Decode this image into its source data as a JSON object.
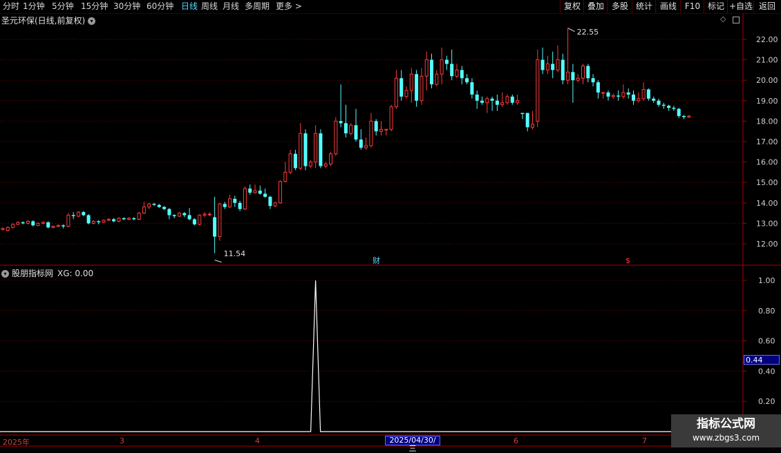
{
  "periods": [
    "分时",
    "1分钟",
    "5分钟",
    "15分钟",
    "30分钟",
    "60分钟",
    "日线",
    "周线",
    "月线",
    "多周期",
    "更多 >"
  ],
  "active_period": "日线",
  "right_buttons": [
    "复权",
    "叠加",
    "多股",
    "统计",
    "画线",
    "F10",
    "标记",
    "+自选",
    "返回"
  ],
  "stock_title": "圣元环保(日线,前复权)",
  "title_icon": "chevron-down-icon",
  "price_axis": [
    "22.00",
    "21.00",
    "20.00",
    "19.00",
    "18.00",
    "17.00",
    "16.00",
    "15.00",
    "14.00",
    "13.00",
    "12.00"
  ],
  "high_label": "22.55",
  "low_label": "11.54",
  "event_markers": [
    "财",
    "$"
  ],
  "indicator_name": "股朋指标网",
  "indicator_value": "XG: 0.00",
  "indicator_axis": [
    "1.00",
    "0.80",
    "0.60",
    "0.40",
    "0.20"
  ],
  "cursor_value": "0.44",
  "date_axis": [
    "2025年",
    "3",
    "4",
    "6",
    "7"
  ],
  "cursor_date": "2025/04/30/三",
  "watermark": {
    "title": "指标公式网",
    "url": "www.zbgs3.com"
  },
  "colors": {
    "up": "#ff3c3c",
    "down": "#54ffff",
    "grid": "#8b0000",
    "active": "#5ad7ff",
    "cursor_bg": "#000080"
  },
  "chart_data": {
    "type": "candlestick",
    "ylim": [
      11.3,
      22.7
    ],
    "candles": [
      [
        12.7,
        12.75,
        12.65,
        12.8
      ],
      [
        12.65,
        12.8,
        12.6,
        12.85
      ],
      [
        12.8,
        12.95,
        12.75,
        13.0
      ],
      [
        12.95,
        13.05,
        12.9,
        13.1
      ],
      [
        13.05,
        13.0,
        12.95,
        13.1
      ],
      [
        13.0,
        13.1,
        12.95,
        13.15
      ],
      [
        13.1,
        12.9,
        12.85,
        13.15
      ],
      [
        12.9,
        13.0,
        12.85,
        13.05
      ],
      [
        13.0,
        13.05,
        12.95,
        13.1
      ],
      [
        13.05,
        12.8,
        12.75,
        13.1
      ],
      [
        12.8,
        12.85,
        12.75,
        12.9
      ],
      [
        12.85,
        12.9,
        12.8,
        12.95
      ],
      [
        12.9,
        12.85,
        12.75,
        12.95
      ],
      [
        12.85,
        13.4,
        12.8,
        13.5
      ],
      [
        13.4,
        13.35,
        13.2,
        13.55
      ],
      [
        13.35,
        13.55,
        13.3,
        13.6
      ],
      [
        13.55,
        13.4,
        13.35,
        13.6
      ],
      [
        13.4,
        13.0,
        12.95,
        13.45
      ],
      [
        13.0,
        13.1,
        12.95,
        13.15
      ],
      [
        13.1,
        13.05,
        12.95,
        13.15
      ],
      [
        13.05,
        13.15,
        13.0,
        13.2
      ],
      [
        13.15,
        13.2,
        13.1,
        13.25
      ],
      [
        13.2,
        13.1,
        13.05,
        13.25
      ],
      [
        13.1,
        13.25,
        13.05,
        13.3
      ],
      [
        13.25,
        13.2,
        13.15,
        13.3
      ],
      [
        13.2,
        13.25,
        13.15,
        13.3
      ],
      [
        13.25,
        13.2,
        13.15,
        13.3
      ],
      [
        13.2,
        13.5,
        13.15,
        13.55
      ],
      [
        13.5,
        13.8,
        13.45,
        14.05
      ],
      [
        13.8,
        13.95,
        13.7,
        14.0
      ],
      [
        13.95,
        13.9,
        13.85,
        14.0
      ],
      [
        13.9,
        13.8,
        13.75,
        13.95
      ],
      [
        13.8,
        13.7,
        13.65,
        13.85
      ],
      [
        13.7,
        13.4,
        13.2,
        13.75
      ],
      [
        13.4,
        13.35,
        13.25,
        13.45
      ],
      [
        13.35,
        13.5,
        13.3,
        13.55
      ],
      [
        13.5,
        13.4,
        13.3,
        13.55
      ],
      [
        13.4,
        13.2,
        13.15,
        13.75
      ],
      [
        13.2,
        12.95,
        12.9,
        13.25
      ],
      [
        12.95,
        13.4,
        12.9,
        13.45
      ],
      [
        13.4,
        13.45,
        13.3,
        13.55
      ],
      [
        13.45,
        13.45,
        13.35,
        13.55
      ],
      [
        13.3,
        12.35,
        11.54,
        14.3
      ],
      [
        12.35,
        13.95,
        12.15,
        14.0
      ],
      [
        13.95,
        13.8,
        13.7,
        14.05
      ],
      [
        13.8,
        14.2,
        13.75,
        14.4
      ],
      [
        14.2,
        14.0,
        13.8,
        14.35
      ],
      [
        14.0,
        13.7,
        13.6,
        14.1
      ],
      [
        13.7,
        14.7,
        13.65,
        14.8
      ],
      [
        14.7,
        14.5,
        14.4,
        14.9
      ],
      [
        14.5,
        14.6,
        14.45,
        14.9
      ],
      [
        14.6,
        14.45,
        14.4,
        14.85
      ],
      [
        14.45,
        14.3,
        14.25,
        14.7
      ],
      [
        14.3,
        13.85,
        13.7,
        14.35
      ],
      [
        13.85,
        14.0,
        13.8,
        14.05
      ],
      [
        14.0,
        15.05,
        13.95,
        15.1
      ],
      [
        15.05,
        15.5,
        15.0,
        16.0
      ],
      [
        15.5,
        16.4,
        15.4,
        16.6
      ],
      [
        16.4,
        15.7,
        15.6,
        16.6
      ],
      [
        15.7,
        17.4,
        15.6,
        17.9
      ],
      [
        17.4,
        15.8,
        15.6,
        17.6
      ],
      [
        15.8,
        16.0,
        15.7,
        16.1
      ],
      [
        16.0,
        17.4,
        15.7,
        17.8
      ],
      [
        17.4,
        15.8,
        15.7,
        17.6
      ],
      [
        15.8,
        15.9,
        15.7,
        16.0
      ],
      [
        15.9,
        16.4,
        15.8,
        16.5
      ],
      [
        16.4,
        18.0,
        16.3,
        18.2
      ],
      [
        18.0,
        17.9,
        17.7,
        19.8
      ],
      [
        17.9,
        17.4,
        17.2,
        18.8
      ],
      [
        17.4,
        17.8,
        17.3,
        17.9
      ],
      [
        17.8,
        17.1,
        17.0,
        18.6
      ],
      [
        17.1,
        16.7,
        16.6,
        17.6
      ],
      [
        16.7,
        16.8,
        16.6,
        17.2
      ],
      [
        16.8,
        18.0,
        16.7,
        18.4
      ],
      [
        18.0,
        17.5,
        17.3,
        18.1
      ],
      [
        17.5,
        17.6,
        17.3,
        18.0
      ],
      [
        17.6,
        17.6,
        17.3,
        17.6
      ],
      [
        17.6,
        18.7,
        17.5,
        18.8
      ],
      [
        18.7,
        20.1,
        18.6,
        20.5
      ],
      [
        20.1,
        19.2,
        19.0,
        20.5
      ],
      [
        19.2,
        19.5,
        19.1,
        19.7
      ],
      [
        19.5,
        20.3,
        18.9,
        20.6
      ],
      [
        20.3,
        19.0,
        18.7,
        20.5
      ],
      [
        19.0,
        20.2,
        18.8,
        20.6
      ],
      [
        20.2,
        21.0,
        19.5,
        21.4
      ],
      [
        21.0,
        19.8,
        19.6,
        21.3
      ],
      [
        19.8,
        20.3,
        19.7,
        20.5
      ],
      [
        20.3,
        21.0,
        19.8,
        21.6
      ],
      [
        21.0,
        20.8,
        20.5,
        21.2
      ],
      [
        20.8,
        20.2,
        20.0,
        21.5
      ],
      [
        20.2,
        20.5,
        20.1,
        20.8
      ],
      [
        20.5,
        20.1,
        19.8,
        20.7
      ],
      [
        20.1,
        19.9,
        19.8,
        20.3
      ],
      [
        19.9,
        19.3,
        19.1,
        20.1
      ],
      [
        19.3,
        19.0,
        18.6,
        19.5
      ],
      [
        19.0,
        18.9,
        18.8,
        19.2
      ],
      [
        18.9,
        19.1,
        18.4,
        19.2
      ],
      [
        19.1,
        19.0,
        18.5,
        19.2
      ],
      [
        19.0,
        18.8,
        18.5,
        19.3
      ],
      [
        18.8,
        18.9,
        18.7,
        19.4
      ],
      [
        18.9,
        19.2,
        18.8,
        19.3
      ],
      [
        19.2,
        18.9,
        18.8,
        19.3
      ],
      [
        18.9,
        19.0,
        18.8,
        19.3
      ],
      [
        18.4,
        18.35,
        18.1,
        18.4
      ],
      [
        18.4,
        17.7,
        17.5,
        18.4
      ],
      [
        17.7,
        17.85,
        17.6,
        18.5
      ],
      [
        18.0,
        21.0,
        17.7,
        21.5
      ],
      [
        21.0,
        20.5,
        20.3,
        21.6
      ],
      [
        20.5,
        20.8,
        20.3,
        21.2
      ],
      [
        20.8,
        20.5,
        20.1,
        21.4
      ],
      [
        20.5,
        21.0,
        20.4,
        21.7
      ],
      [
        21.0,
        20.0,
        19.8,
        21.3
      ],
      [
        20.0,
        20.4,
        19.8,
        22.55
      ],
      [
        20.4,
        20.0,
        18.9,
        20.8
      ],
      [
        20.0,
        20.1,
        19.9,
        20.3
      ],
      [
        20.1,
        20.7,
        19.8,
        20.8
      ],
      [
        20.7,
        20.1,
        19.9,
        20.8
      ],
      [
        20.1,
        19.9,
        19.7,
        20.3
      ],
      [
        19.9,
        19.4,
        19.1,
        20.0
      ],
      [
        19.4,
        19.4,
        19.1,
        19.4
      ],
      [
        19.4,
        19.2,
        19.0,
        19.5
      ],
      [
        19.2,
        19.25,
        19.1,
        19.35
      ],
      [
        19.25,
        19.2,
        19.0,
        19.5
      ],
      [
        19.2,
        19.4,
        19.1,
        19.8
      ],
      [
        19.4,
        19.3,
        19.1,
        19.6
      ],
      [
        19.3,
        19.0,
        18.8,
        19.5
      ],
      [
        19.0,
        19.1,
        18.9,
        19.4
      ],
      [
        19.1,
        19.55,
        19.0,
        19.9
      ],
      [
        19.55,
        19.1,
        19.0,
        19.6
      ],
      [
        19.1,
        19.0,
        18.9,
        19.2
      ],
      [
        19.0,
        18.8,
        18.7,
        19.1
      ],
      [
        18.8,
        18.75,
        18.6,
        18.9
      ],
      [
        18.75,
        18.65,
        18.5,
        18.8
      ],
      [
        18.65,
        18.6,
        18.5,
        18.75
      ],
      [
        18.6,
        18.25,
        18.15,
        18.65
      ],
      [
        18.25,
        18.2,
        18.1,
        18.3
      ],
      [
        18.2,
        18.25,
        18.15,
        18.3
      ]
    ],
    "indicator": {
      "name": "XG",
      "ylim": [
        0,
        1
      ],
      "peak_index": 62,
      "peak_value": 1.0
    }
  }
}
